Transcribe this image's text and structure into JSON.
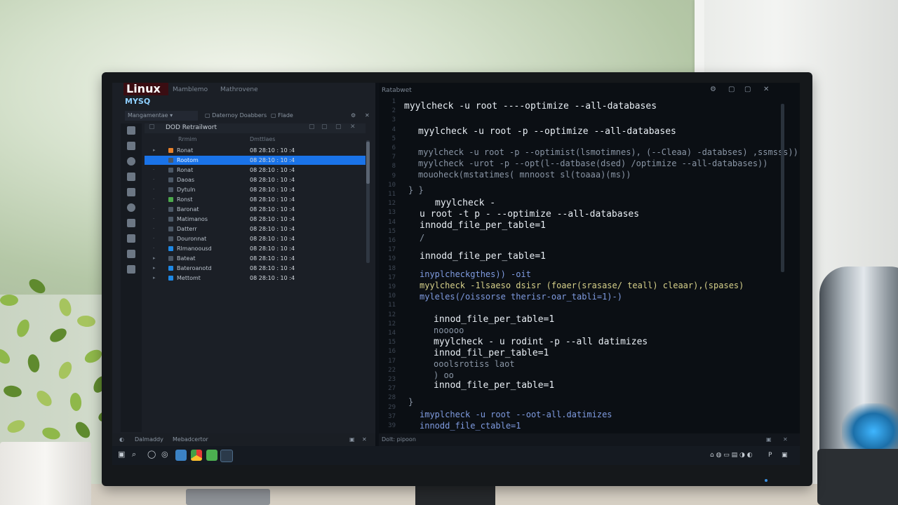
{
  "left_pane": {
    "brand": "Linux",
    "brand_sub": "MYSQ",
    "top_tabs": [
      "Mamblemo",
      "Mathrovene"
    ],
    "dropdown_label": "Mangamentae",
    "toolbar_items": [
      "Daternoy Doabbers",
      "Flade"
    ],
    "tree_header": "DOD Retrailwort",
    "column_headers": [
      "Rrmim",
      "Dmttlaes"
    ],
    "tree_rows": [
      {
        "name": "Ronat",
        "value": "08 28:10 : 10 :4",
        "color": "#e8812a",
        "selected": false
      },
      {
        "name": "Rootom",
        "value": "08 28:10 : 10 :4",
        "color": "#4c5866",
        "selected": true
      },
      {
        "name": "Ronat",
        "value": "08 28:10 : 10 :4",
        "color": "#4c5866",
        "selected": false
      },
      {
        "name": "Daoas",
        "value": "08 28:10 : 10 :4",
        "color": "#4c5866",
        "selected": false
      },
      {
        "name": "Dytuln",
        "value": "08 28:10 : 10 :4",
        "color": "#4c5866",
        "selected": false
      },
      {
        "name": "Ronst",
        "value": "08 28:10 : 10 :4",
        "color": "#4caa4c",
        "selected": false
      },
      {
        "name": "Baronat",
        "value": "08 28:10 : 10 :4",
        "color": "#4c5866",
        "selected": false
      },
      {
        "name": "Matimanos",
        "value": "08 28:10 : 10 :4",
        "color": "#4c5866",
        "selected": false
      },
      {
        "name": "Datterr",
        "value": "08 28:10 : 10 :4",
        "color": "#4c5866",
        "selected": false
      },
      {
        "name": "Douronnat",
        "value": "08 28:10 : 10 :4",
        "color": "#4c5866",
        "selected": false
      },
      {
        "name": "Rlmanoousd",
        "value": "08 28:10 : 10 :4",
        "color": "#1e88e5",
        "selected": false
      },
      {
        "name": "Bateat",
        "value": "08 28:10 : 10 :4",
        "color": "#4c5866",
        "selected": false
      },
      {
        "name": "Bateroanotd",
        "value": "08 28:10 : 10 :4",
        "color": "#1e88e5",
        "selected": false
      },
      {
        "name": "Mettomt",
        "value": "08 28:10 : 10 :4",
        "color": "#1e88e5",
        "selected": false
      }
    ],
    "status_left": "Dalmaddy",
    "status_right": "Mebadcertor"
  },
  "editor": {
    "title": "Ratabwet",
    "status": "Dolt: pipoon",
    "line_numbers": [
      "1",
      "2",
      "3",
      "4",
      "5",
      "6",
      "7",
      "8",
      "9",
      "10",
      "11",
      "12",
      "13",
      "14",
      "15",
      "16",
      "17",
      "19",
      "18",
      "17",
      "19",
      "10",
      "11",
      "12",
      "12",
      "14",
      "15",
      "16",
      "17",
      "22",
      "23",
      "27",
      "28",
      "29",
      "37",
      "39"
    ],
    "lines": [
      {
        "text": "myylcheck -u root ----optimize --all-databases",
        "cls": "c-main"
      },
      {
        "text": "myylcheck -u root -p --optimize --all-databases",
        "cls": "c-main"
      },
      {
        "text": "myylcheck -u root -p --optimist(lsmotimnes), (--Cleaa) -databses) ,ssmsss))",
        "cls": "c-dim"
      },
      {
        "text": "myylcheck -urot -p --opt(l--datbase(dsed) /optimize --all-databases))",
        "cls": "c-dim"
      },
      {
        "text": "mouoheck(mstatimes( mnnoost sl(toaaa)(ms))",
        "cls": "c-dim"
      },
      {
        "text": "} }",
        "cls": "c-dim"
      },
      {
        "text": "myylcheck -",
        "cls": "c-main"
      },
      {
        "text": "u root -t p - --optimize --all-databases",
        "cls": "c-main"
      },
      {
        "text": "innodd_file_per_table=1",
        "cls": "c-main"
      },
      {
        "text": "/",
        "cls": "c-dim"
      },
      {
        "text": "innodd_file_per_table=1",
        "cls": "c-main"
      },
      {
        "text": "inyplcheckgthes)) -oit",
        "cls": "c-blue"
      },
      {
        "text": "myylcheck -1lsaeso dsisr (foaer(srasase/ teall) cleaar),(spases)",
        "cls": "c-yellow"
      },
      {
        "text": "myleles(/oissorse therisr-oar_tabli=1)-)",
        "cls": "c-blue"
      },
      {
        "text": "innod_file_per_table=1",
        "cls": "c-main"
      },
      {
        "text": "nooooo",
        "cls": "c-dim"
      },
      {
        "text": "myylcheck - u rodint -p --all datimizes",
        "cls": "c-main"
      },
      {
        "text": "innod_fil_per_table=1",
        "cls": "c-main"
      },
      {
        "text": "ooolsrotiss laot",
        "cls": "c-dim"
      },
      {
        "text": ") oo",
        "cls": "c-dim"
      },
      {
        "text": "innod_file_per_table=1",
        "cls": "c-main"
      },
      {
        "text": "}",
        "cls": "c-dim"
      },
      {
        "text": "imyplcheck -u root --oot-all.datimizes",
        "cls": "c-blue"
      },
      {
        "text": "innodd_file_ctable=1",
        "cls": "c-blue"
      }
    ]
  },
  "taskbar": {
    "tray_clock": "P"
  }
}
